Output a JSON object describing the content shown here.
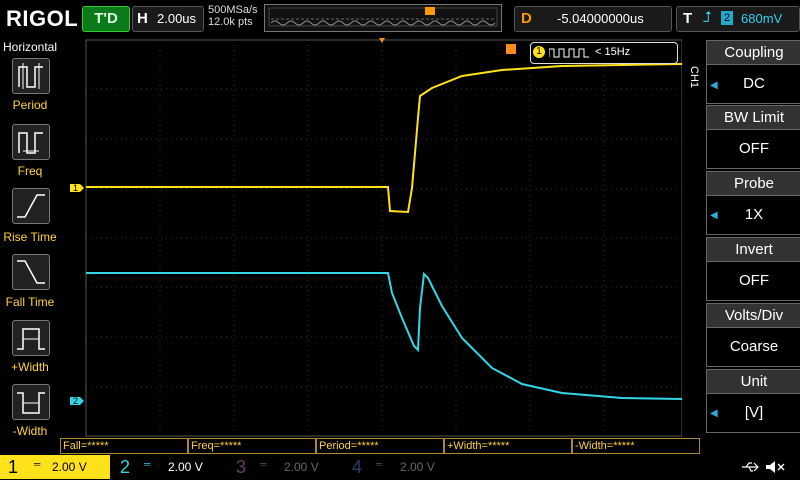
{
  "top": {
    "brand": "RIGOL",
    "trigger_state": "T'D",
    "horizontal_label": "H",
    "timebase": "2.00us",
    "sample_rate": "500MSa/s",
    "points": "12.0k pts",
    "delay_label": "D",
    "delay": "-5.04000000us",
    "trigger_label": "T",
    "trigger_source": "2",
    "trigger_level": "680mV"
  },
  "left_panel": {
    "title": "Horizontal",
    "items": [
      "Period",
      "Freq",
      "Rise Time",
      "Fall Time",
      "+Width",
      "-Width"
    ]
  },
  "measure_box": {
    "channel": "1",
    "text": "< 15Hz"
  },
  "right_panel": {
    "side_tag": "CH1",
    "menus": [
      {
        "title": "Coupling",
        "value": "DC"
      },
      {
        "title": "BW Limit",
        "value": "OFF"
      },
      {
        "title": "Probe",
        "value": "1X"
      },
      {
        "title": "Invert",
        "value": "OFF"
      },
      {
        "title": "Volts/Div",
        "value": "Coarse"
      },
      {
        "title": "Unit",
        "value": "[V]"
      }
    ]
  },
  "measurements": [
    "Fall=*****",
    "Freq=*****",
    "Period=*****",
    "+Width=*****",
    "-Width=*****"
  ],
  "channels": [
    {
      "num": "1",
      "scale": "2.00 V",
      "color": "#ffe21a"
    },
    {
      "num": "2",
      "scale": "2.00 V",
      "color": "#33d6e6"
    },
    {
      "num": "3",
      "scale": "2.00 V",
      "color": "#b04aa0"
    },
    {
      "num": "4",
      "scale": "2.00 V",
      "color": "#4a7adf"
    }
  ],
  "colors": {
    "ch1": "#ffe21a",
    "ch2": "#33d6e6",
    "trigger": "#ff8c1a",
    "accent": "#ffd23c"
  }
}
